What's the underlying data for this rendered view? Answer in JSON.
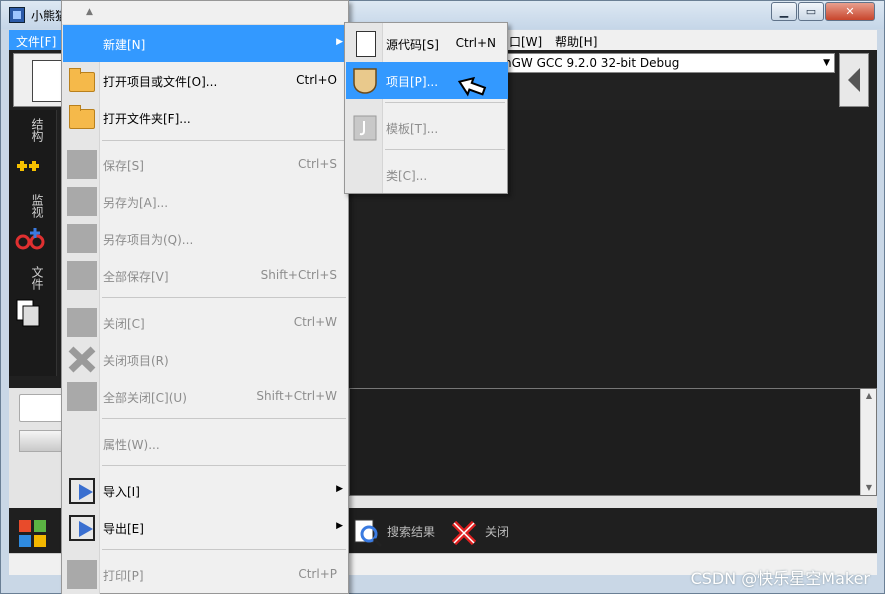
{
  "window": {
    "title": "小熊猫",
    "controls": [
      "▁",
      "▭",
      "✕"
    ]
  },
  "menubar": {
    "file": "文件[F]",
    "window": "口[W]",
    "help": "帮助[H]"
  },
  "toolbar": {
    "compiler": "nGW GCC 9.2.0 32-bit Debug"
  },
  "sidebar": {
    "tabs": [
      "结构",
      "监视",
      "文件"
    ]
  },
  "file_menu": {
    "scroll_up": "▲",
    "items": [
      {
        "label": "新建[N]",
        "shortcut": "",
        "submenu": true,
        "state": "highlighted",
        "icon": "none"
      },
      {
        "label": "打开项目或文件[O]...",
        "shortcut": "Ctrl+O",
        "state": "enabled",
        "icon": "folder-icon"
      },
      {
        "label": "打开文件夹[F]...",
        "shortcut": "",
        "state": "enabled",
        "icon": "folder-icon"
      },
      {
        "label": "保存[S]",
        "shortcut": "Ctrl+S",
        "state": "disabled",
        "icon": "save-icon"
      },
      {
        "label": "另存为[A]...",
        "shortcut": "",
        "state": "disabled",
        "icon": "save-as-icon"
      },
      {
        "label": "另存项目为(Q)...",
        "shortcut": "",
        "state": "disabled",
        "icon": "save-project-as-icon"
      },
      {
        "label": "全部保存[V]",
        "shortcut": "Shift+Ctrl+S",
        "state": "disabled",
        "icon": "save-all-icon"
      },
      {
        "label": "关闭[C]",
        "shortcut": "Ctrl+W",
        "state": "disabled",
        "icon": "close-file-icon"
      },
      {
        "label": "关闭项目(R)",
        "shortcut": "",
        "state": "disabled",
        "icon": "close-project-icon"
      },
      {
        "label": "全部关闭[C](U)",
        "shortcut": "Shift+Ctrl+W",
        "state": "disabled",
        "icon": "close-all-icon"
      },
      {
        "label": "属性(W)...",
        "shortcut": "",
        "state": "disabled",
        "icon": "none"
      },
      {
        "label": "导入[I]",
        "shortcut": "",
        "submenu": true,
        "state": "enabled",
        "icon": "import-icon"
      },
      {
        "label": "导出[E]",
        "shortcut": "",
        "submenu": true,
        "state": "enabled",
        "icon": "export-icon"
      },
      {
        "label": "打印[P]",
        "shortcut": "Ctrl+P",
        "state": "disabled",
        "icon": "print-icon"
      }
    ]
  },
  "new_submenu": {
    "items": [
      {
        "label": "源代码[S]",
        "shortcut": "Ctrl+N",
        "state": "enabled",
        "icon": "source-file-icon"
      },
      {
        "label": "项目[P]...",
        "shortcut": "",
        "state": "highlighted",
        "icon": "project-icon"
      },
      {
        "label": "模板[T]...",
        "shortcut": "",
        "state": "disabled",
        "icon": "template-icon"
      },
      {
        "label": "类[C]...",
        "shortcut": "",
        "state": "disabled",
        "icon": "none"
      }
    ]
  },
  "bottom_tabs": {
    "search_results": "搜索结果",
    "close": "关闭"
  },
  "watermark": "CSDN @快乐星空Maker",
  "colors": {
    "highlight": "#3399ff",
    "menu_bg": "#f0f0f0",
    "disabled_text": "#8d8d8d",
    "editor_bg": "#202020"
  }
}
